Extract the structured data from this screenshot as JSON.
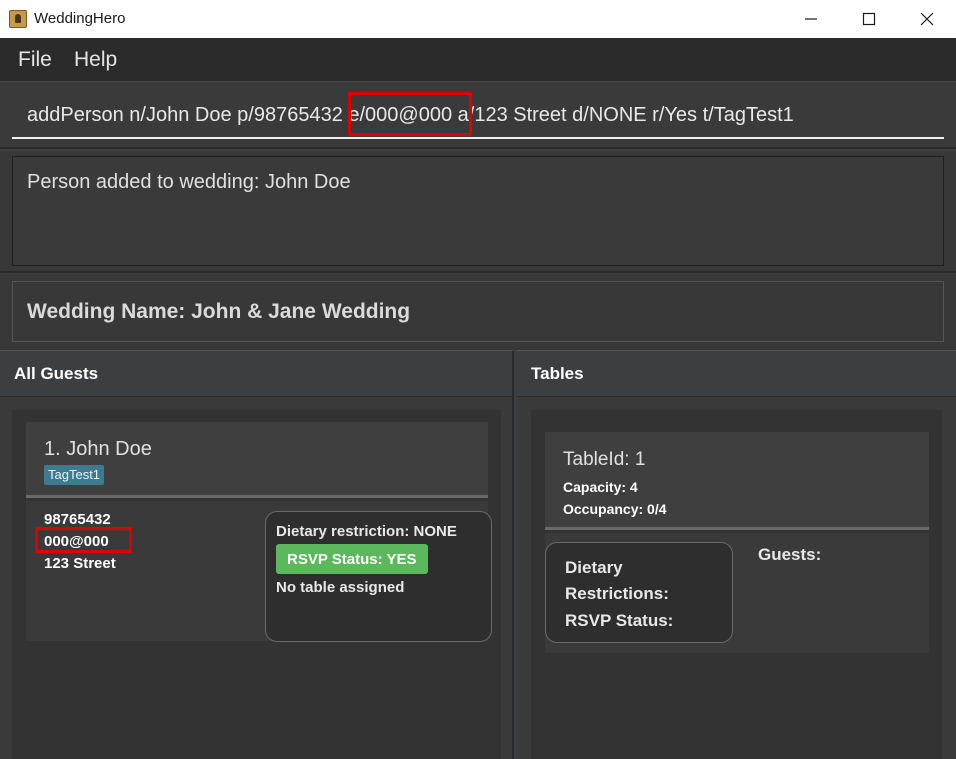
{
  "window": {
    "title": "WeddingHero"
  },
  "menu": {
    "file": "File",
    "help": "Help"
  },
  "command": {
    "value": "addPerson n/John Doe p/98765432 e/000@000 a/123 Street d/NONE r/Yes t/TagTest1"
  },
  "result": {
    "text": "Person added to wedding: John Doe"
  },
  "wedding": {
    "name_label": "Wedding Name: John & Jane Wedding"
  },
  "guests_panel": {
    "title": "All Guests",
    "guest": {
      "name": "1. John Doe",
      "tag": "TagTest1",
      "phone": "98765432",
      "email": "000@000",
      "address": "123 Street",
      "dietary": "Dietary restriction: NONE",
      "rsvp": "RSVP Status: YES",
      "table": "No table assigned"
    }
  },
  "tables_panel": {
    "title": "Tables",
    "table": {
      "id": "TableId: 1",
      "capacity": "Capacity: 4",
      "occupancy": "Occupancy: 0/4",
      "dietary_line1": "Dietary",
      "dietary_line2": "Restrictions:",
      "rsvp": "RSVP Status:",
      "guests_label": "Guests:"
    }
  },
  "colors": {
    "highlight": "#e00000",
    "tag": "#3e7b91",
    "rsvp_yes": "#5cb85c"
  }
}
